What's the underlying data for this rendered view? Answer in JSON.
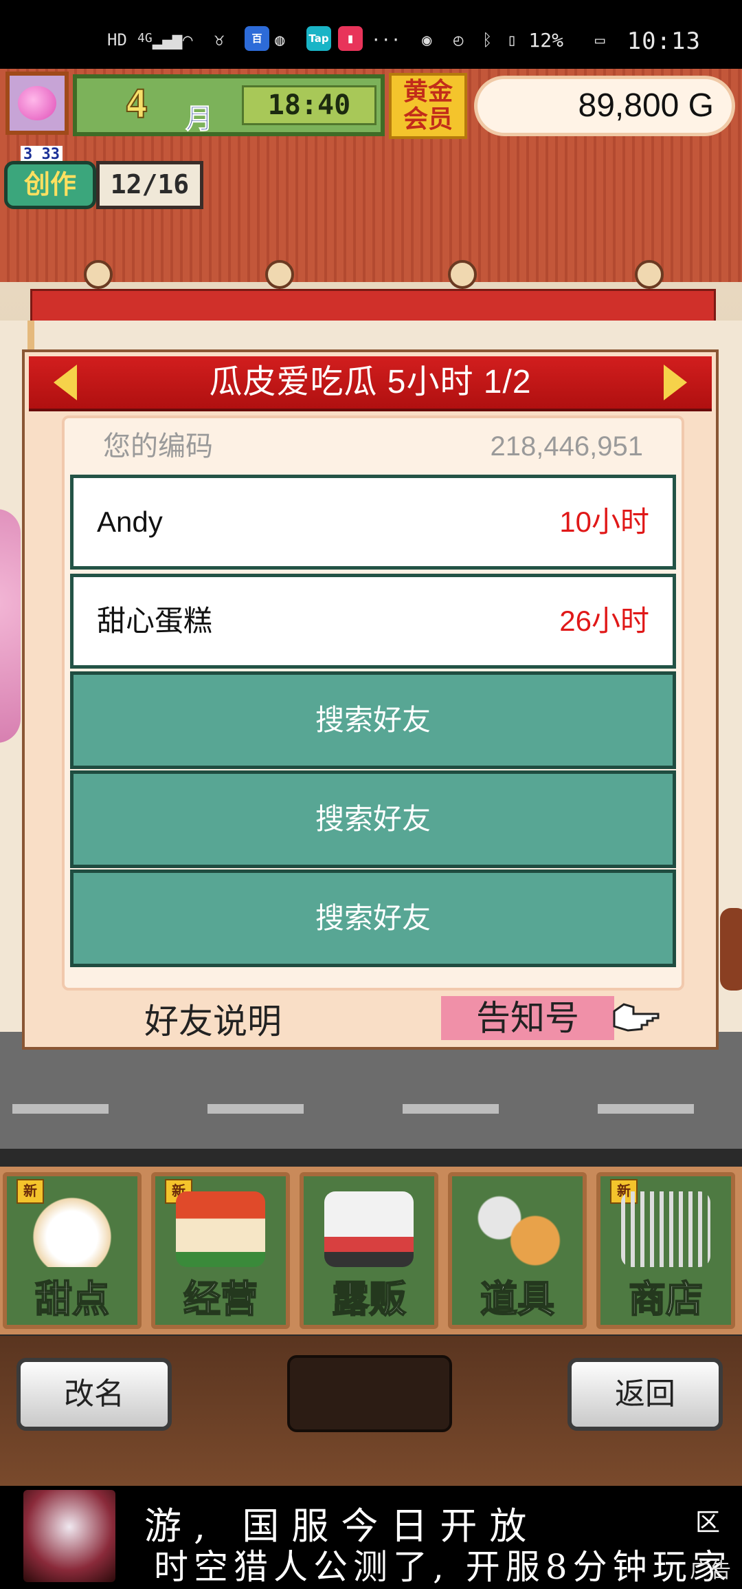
{
  "status_bar": {
    "icons": [
      "HD",
      "4G",
      "signal-icon",
      "wifi-icon",
      "alarm-app-icon",
      "baidu-app-icon",
      "wechat-icon",
      "taptap-icon",
      "book-app-icon",
      "more-icon",
      "eye-icon",
      "alarm-icon",
      "bluetooth-icon",
      "vibrate-icon"
    ],
    "hd": "HD",
    "network": "4G",
    "tap": "Tap",
    "more": "···",
    "battery_text": "12%",
    "time": "10:13"
  },
  "hud": {
    "month_number": "4",
    "month_label": "月",
    "clock": "18:40",
    "gold_member_line1": "黄金",
    "gold_member_line2": "会员",
    "money": "89,800 G"
  },
  "creation": {
    "top_numbers": "3 33",
    "label": "创作",
    "count": "12/16"
  },
  "dialog": {
    "title": "瓜皮爱吃瓜  5小时 1/2",
    "code_label": "您的编码",
    "code_value": "218,446,951",
    "friends": [
      {
        "name": "Andy",
        "time": "10小时"
      },
      {
        "name": "甜心蛋糕",
        "time": "26小时"
      }
    ],
    "search_slots": [
      "搜索好友",
      "搜索好友",
      "搜索好友"
    ],
    "help_label": "好友说明",
    "notify_label": "告知号"
  },
  "menu": {
    "new_tag": "新",
    "items": [
      {
        "label": "甜点",
        "icon": "cake-icon",
        "is_new": true
      },
      {
        "label": "经营",
        "icon": "shop-icon",
        "is_new": true
      },
      {
        "label": "露贩",
        "icon": "food-truck-icon",
        "is_new": false
      },
      {
        "label": "道具",
        "icon": "item-bag-icon",
        "is_new": false
      },
      {
        "label": "商店",
        "icon": "cart-icon",
        "is_new": true
      }
    ]
  },
  "bottom_buttons": {
    "rename": "改名",
    "back": "返回"
  },
  "ad": {
    "line1": "游, 国服今日开放",
    "line2": "时空猎人公测了, 开服8分钟玩家",
    "tag": "广告",
    "close": "区"
  },
  "colors": {
    "dialog_header": "#c81616",
    "friend_time": "#e01818",
    "search_slot": "#58a694",
    "notify_highlight": "#f090a8",
    "menu_button": "#4e7a42"
  }
}
